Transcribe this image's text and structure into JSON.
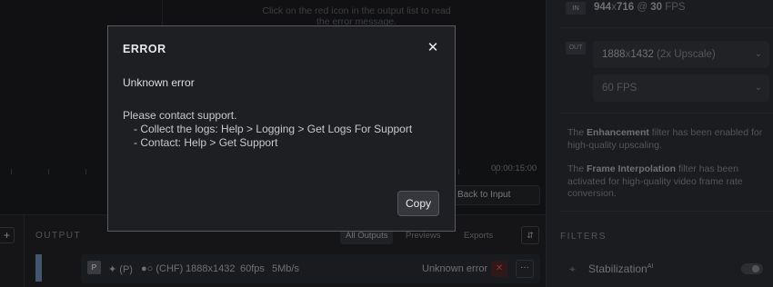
{
  "preview": {
    "hint": "Click on the red icon in the output list to read the error message.",
    "timecode": "00:00:15:00",
    "back_to_input": "Back to Input"
  },
  "output": {
    "add_label": "+",
    "section_label": "OUTPUT",
    "tabs": [
      "All Outputs",
      "Previews",
      "Exports"
    ],
    "sort_icon": "sort-icon",
    "row": {
      "badge": "P",
      "enhance": "(P)",
      "interp": "(CHF)",
      "resolution": "1888x1432",
      "fps": "60fps",
      "bitrate": "5Mb/s",
      "status": "Unknown error",
      "error_icon": "✕",
      "more_icon": "···"
    }
  },
  "right": {
    "in_badge": "IN",
    "in_w": "944",
    "in_h": "716",
    "in_at": "@",
    "in_fps": "30",
    "in_fps_unit": "FPS",
    "out_badge": "OUT",
    "out_res": "1888",
    "out_res_h": "1432",
    "out_scale": "(2x Upscale)",
    "out_fps": "60 FPS",
    "enh_pre": "The ",
    "enh_bold": "Enhancement",
    "enh_post": " filter has been enabled for high-quality upscaling.",
    "fi_pre": "The ",
    "fi_bold": "Frame Interpolation",
    "fi_post": " filter has been activated for high-quality video frame rate conversion.",
    "filters_label": "FILTERS",
    "stab_label": "Stabilization",
    "stab_sup": "AI"
  },
  "dialog": {
    "title": "ERROR",
    "message": "Unknown error",
    "body_line1": "Please contact support.",
    "body_line2": "- Collect the logs: Help > Logging > Get Logs For Support",
    "body_line3": "- Contact: Help > Get Support",
    "copy_label": "Copy"
  },
  "colors": {
    "error_red": "#c8383c",
    "accent": "#55708f"
  }
}
